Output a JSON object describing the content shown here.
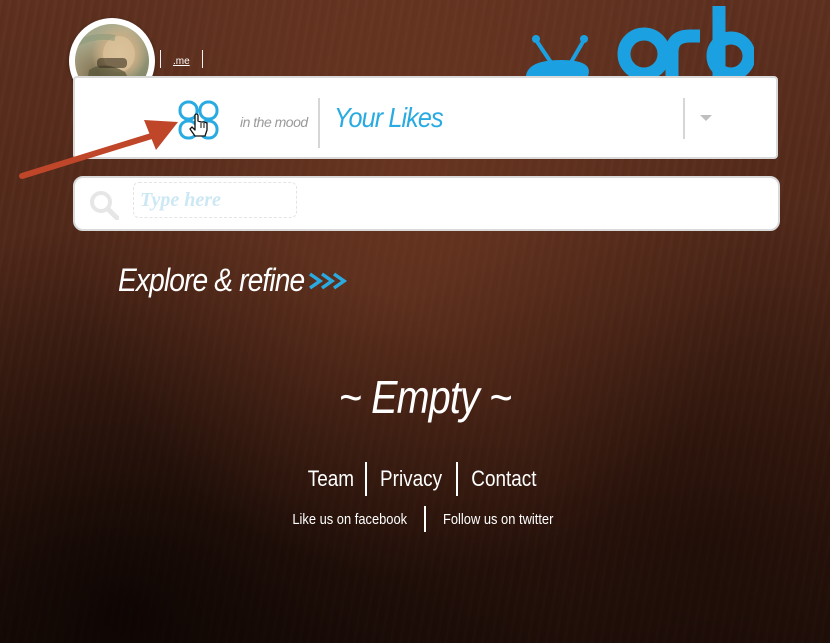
{
  "header": {
    "profile_link": ".me",
    "logo": {
      "text": "orb",
      "icon": "tv-antenna-icon",
      "color": "#1ba1e2"
    }
  },
  "mood_bar": {
    "icon": "clover-mood-icon",
    "cursor": "hand-pointer-icon",
    "label": "in the mood",
    "selected_value": "Your Likes",
    "dropdown_icon": "chevron-down-icon",
    "accent_color": "#29abe2"
  },
  "search": {
    "icon": "search-icon",
    "placeholder": "Type here",
    "value": ""
  },
  "explore": {
    "label": "Explore & refine",
    "icon": "triple-chevron-right-icon"
  },
  "main": {
    "empty_message": "~ Empty ~"
  },
  "footer": {
    "links": [
      "Team",
      "Privacy",
      "Contact"
    ],
    "social": [
      "Like us on facebook",
      "Follow us on twitter"
    ]
  },
  "annotation": {
    "icon": "red-arrow-icon",
    "color": "#c0462a"
  }
}
